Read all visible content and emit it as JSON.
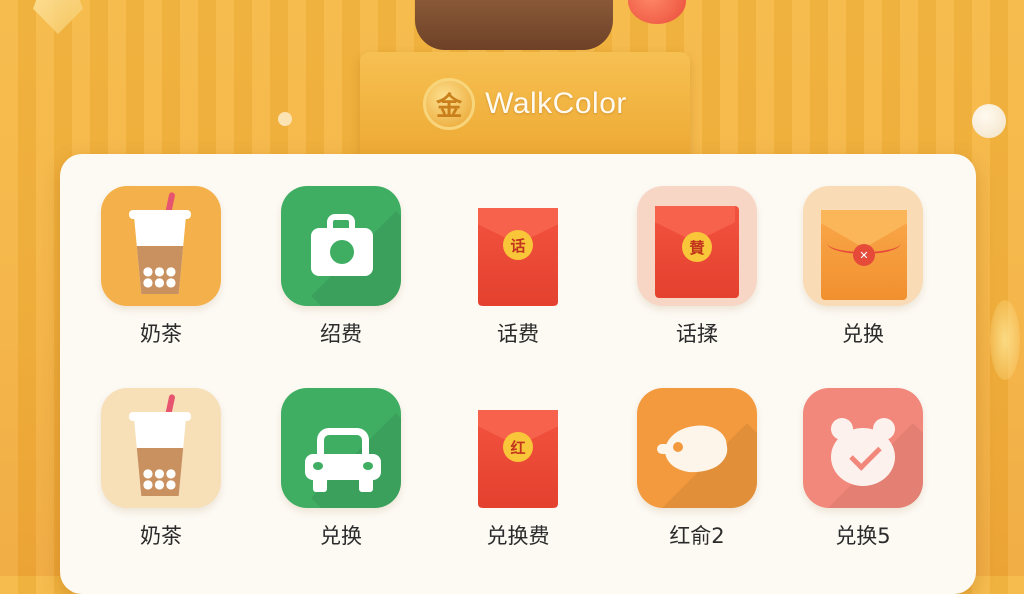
{
  "header": {
    "logo_glyph": "金",
    "brand": "WalkColor"
  },
  "colors": {
    "background": "#f5b63f",
    "panel": "#fdfaf4",
    "green": "#3fae63",
    "red_envelope": "#e4412f",
    "orange": "#f39a3e",
    "salmon": "#f2877b"
  },
  "grid": {
    "items": [
      {
        "label": "奶茶",
        "icon": "milk-tea-icon"
      },
      {
        "label": "绍费",
        "icon": "camera-icon"
      },
      {
        "label": "话费",
        "icon": "red-envelope-icon",
        "seal": "话"
      },
      {
        "label": "话揉",
        "icon": "red-envelope-icon",
        "seal": "賛"
      },
      {
        "label": "兑换",
        "icon": "orange-envelope-icon",
        "seal": "✕"
      },
      {
        "label": "奶茶",
        "icon": "milk-tea-icon"
      },
      {
        "label": "兑换",
        "icon": "car-icon"
      },
      {
        "label": "兑换费",
        "icon": "red-envelope-icon",
        "seal": "红"
      },
      {
        "label": "红俞2",
        "icon": "tag-icon"
      },
      {
        "label": "兑换5",
        "icon": "bear-check-icon"
      }
    ]
  }
}
